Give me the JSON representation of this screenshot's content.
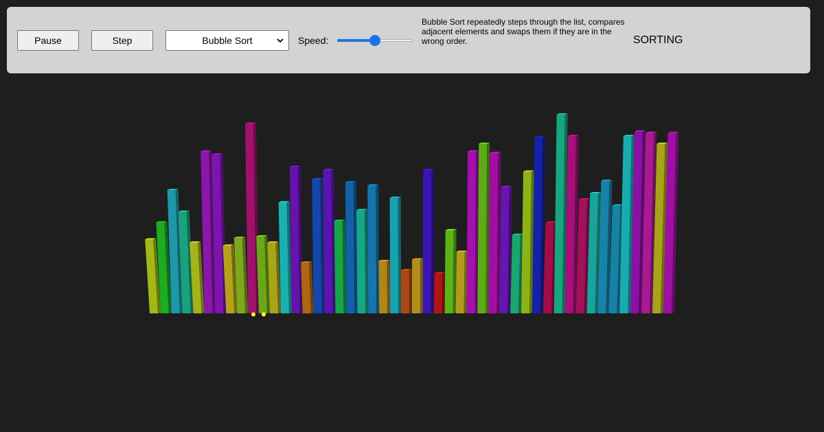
{
  "toolbar": {
    "pause_label": "Pause",
    "step_label": "Step",
    "algorithm_selected": "Bubble Sort",
    "speed_label": "Speed:",
    "speed_value": 0.5,
    "description": "Bubble Sort repeatedly steps through the list, compares adjacent elements and swaps them if they are in the wrong order.",
    "status": "SORTING"
  },
  "visualization": {
    "bar_values": [
      48,
      59,
      80,
      66,
      46,
      105,
      103,
      44,
      49,
      123,
      50,
      46,
      72,
      95,
      33,
      87,
      93,
      60,
      85,
      67,
      83,
      34,
      75,
      28,
      35,
      93,
      26,
      54,
      40,
      105,
      110,
      104,
      82,
      51,
      92,
      114,
      59,
      129,
      115,
      74,
      78,
      86,
      70,
      115,
      118,
      117,
      110,
      117
    ],
    "bar_colors": [
      "#a3b816",
      "#1cab23",
      "#1d98a8",
      "#18a37d",
      "#a6b31a",
      "#8a17aa",
      "#7c15b0",
      "#b5a11c",
      "#7ea81b",
      "#a1116c",
      "#6aa817",
      "#a8a519",
      "#1ab0b0",
      "#6413ab",
      "#b06613",
      "#1546ad",
      "#5a14b0",
      "#16a647",
      "#1261a8",
      "#16a68a",
      "#1675ab",
      "#b0851a",
      "#18a2b0",
      "#ad4815",
      "#b08e18",
      "#3b14b3",
      "#b01414",
      "#5bb317",
      "#b09c1a",
      "#a310ad",
      "#5dab17",
      "#a30fa3",
      "#6616b0",
      "#1aa66e",
      "#8bb317",
      "#1521a6",
      "#a10d4c",
      "#17a680",
      "#a80f7a",
      "#a3105c",
      "#18a39c",
      "#1783a8",
      "#1582a6",
      "#19abb0",
      "#8c10a3",
      "#a81a90",
      "#a8a319",
      "#9e0fa3",
      "#a310a0",
      "#b05c15"
    ],
    "pointer_color": "#ffff33"
  }
}
